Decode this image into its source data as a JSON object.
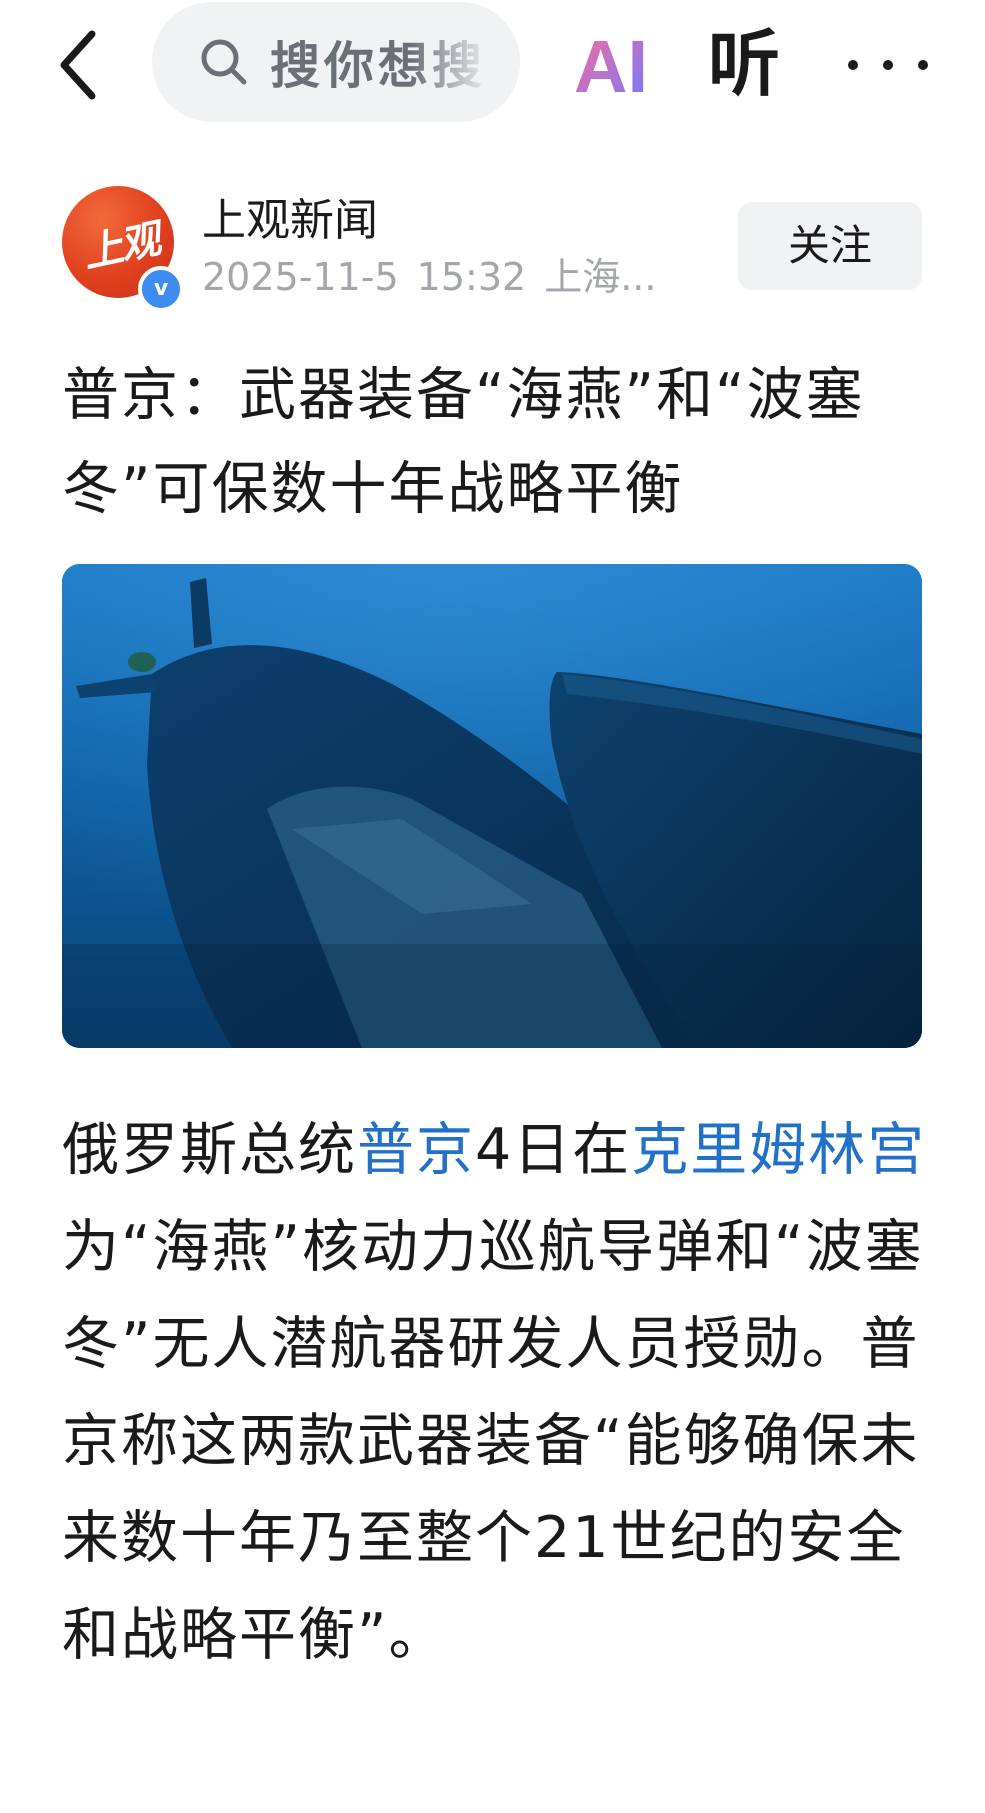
{
  "topbar": {
    "search_placeholder": "搜你想搜",
    "ai_label": "AI",
    "listen_label": "听"
  },
  "author": {
    "avatar_text": "上观",
    "verified_mark": "v",
    "name": "上观新闻",
    "date": "2025-11-5",
    "time": "15:32",
    "location": "上海...",
    "follow_label": "关注"
  },
  "article": {
    "headline": "普京：武器装备“海燕”和“波塞冬”可保数十年战略平衡",
    "body": {
      "part1": "俄罗斯总统",
      "link1": "普京",
      "part2": "4日在",
      "link2": "克里姆林宫",
      "part3": "为“海燕”核动力巡航导弹和“波塞冬”无人潜航器研发人员授勋。普京称这两款武器装备“能够确保未来数十年乃至整个21世纪的安全和战略平衡”。"
    }
  },
  "colors": {
    "link": "#2170c9",
    "avatar_red": "#e0401e",
    "verified_blue": "#3d8cf0",
    "ai_gradient_start": "#ff6b9a",
    "ai_gradient_end": "#6f7bff",
    "photo_water": "#0b5a99"
  },
  "icons": {
    "back": "chevron-left-icon",
    "search": "search-icon",
    "more": "more-dots-icon"
  }
}
